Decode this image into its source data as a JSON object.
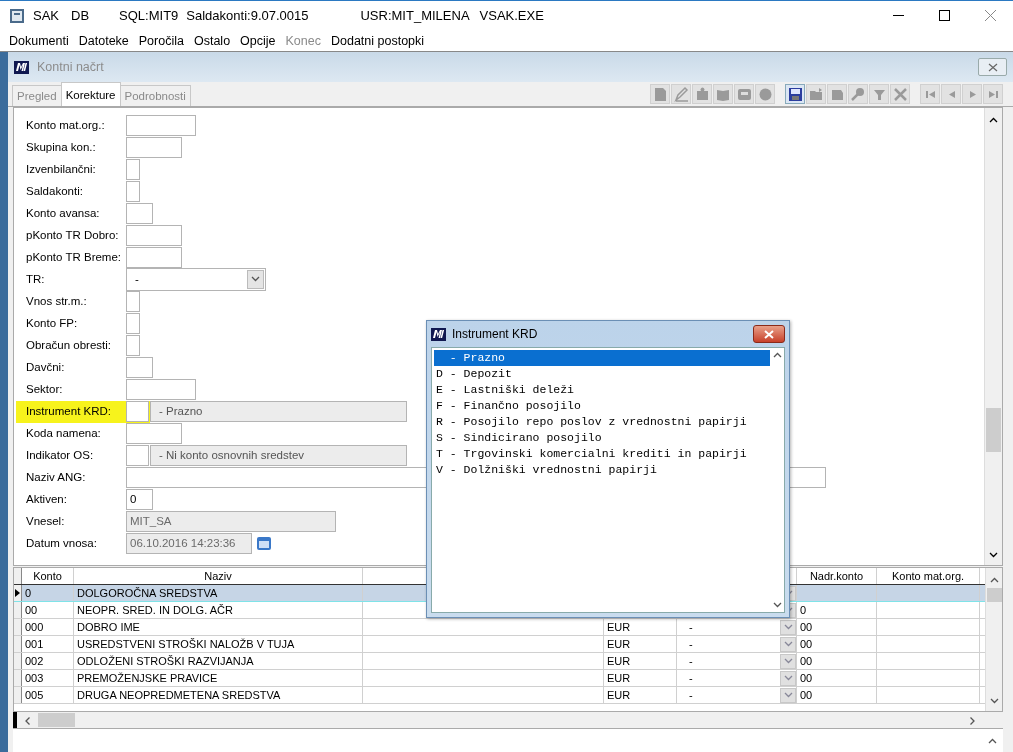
{
  "window": {
    "title_parts": [
      "SAK",
      "DB",
      "SQL:MIT9",
      "Saldakonti:9.07.0015",
      "USR:MIT_MILENA",
      "VSAK.EXE"
    ]
  },
  "menu": [
    {
      "label": "Dokumenti",
      "disabled": false
    },
    {
      "label": "Datoteke",
      "disabled": false
    },
    {
      "label": "Poročila",
      "disabled": false
    },
    {
      "label": "Ostalo",
      "disabled": false
    },
    {
      "label": "Opcije",
      "disabled": false
    },
    {
      "label": "Konec",
      "disabled": true
    },
    {
      "label": "Dodatni postopki",
      "disabled": false
    }
  ],
  "child_window": {
    "title": "Kontni načrt"
  },
  "tabs": [
    {
      "label": "Pregled",
      "selected": false
    },
    {
      "label": "Korekture",
      "selected": true
    },
    {
      "label": "Podrobnosti",
      "selected": false
    }
  ],
  "toolbar": [
    {
      "kind": "document",
      "disabled": true
    },
    {
      "kind": "pencil",
      "disabled": true
    },
    {
      "kind": "puzzle",
      "disabled": true
    },
    {
      "kind": "book",
      "disabled": true
    },
    {
      "kind": "card",
      "disabled": true
    },
    {
      "kind": "circle",
      "disabled": true
    },
    {
      "kind": "save",
      "disabled": false
    },
    {
      "kind": "folder-open",
      "disabled": true
    },
    {
      "kind": "folder",
      "disabled": true
    },
    {
      "kind": "magnifier",
      "disabled": true
    },
    {
      "kind": "filter",
      "disabled": true
    },
    {
      "kind": "cross",
      "disabled": true
    },
    {
      "kind": "first",
      "disabled": true
    },
    {
      "kind": "prev",
      "disabled": true
    },
    {
      "kind": "next",
      "disabled": true
    },
    {
      "kind": "last",
      "disabled": true
    }
  ],
  "form": [
    {
      "label": "Konto mat.org.:",
      "kind": "medium"
    },
    {
      "label": "Skupina kon.:",
      "kind": "short"
    },
    {
      "label": "Izvenbilančni:",
      "kind": "tiny"
    },
    {
      "label": "Saldakonti:",
      "kind": "tiny"
    },
    {
      "label": "Konto avansa:",
      "kind": "small"
    },
    {
      "label": "pKonto TR Dobro:",
      "kind": "short"
    },
    {
      "label": "pKonto TR Breme:",
      "kind": "short"
    },
    {
      "label": "TR:",
      "kind": "combo",
      "value": "-"
    },
    {
      "label": "Vnos str.m.:",
      "kind": "tiny"
    },
    {
      "label": "Konto FP:",
      "kind": "tiny"
    },
    {
      "label": "Obračun obresti:",
      "kind": "tiny"
    },
    {
      "label": "Davčni:",
      "kind": "small"
    },
    {
      "label": "Sektor:",
      "kind": "medium"
    },
    {
      "label": "Instrument KRD:",
      "kind": "lookup",
      "description": "- Prazno",
      "highlighted": true
    },
    {
      "label": "Koda namena:",
      "kind": "short"
    },
    {
      "label": "Indikator OS:",
      "kind": "lookup",
      "description": "- Ni konto osnovnih sredstev",
      "highlighted": false
    },
    {
      "label": "Naziv ANG:",
      "kind": "full"
    },
    {
      "label": "Aktiven:",
      "kind": "small",
      "value": "0"
    },
    {
      "label": "Vnesel:",
      "kind": "readonly",
      "value": "MIT_SA"
    },
    {
      "label": "Datum vnosa:",
      "kind": "date",
      "value": "06.10.2016 14:23:36"
    }
  ],
  "table": {
    "columns": [
      "Konto",
      "Naziv",
      "Nadr.konto",
      "Konto mat.org."
    ],
    "rows": [
      {
        "konto": "0",
        "naziv": "DOLGOROČNA SREDSTVA",
        "selected": true
      },
      {
        "konto": "00",
        "naziv": "NEOPR. SRED. IN DOLG. AČR",
        "nadr_konto": "0",
        "selected": false
      },
      {
        "konto": "000",
        "naziv": "DOBRO IME",
        "currency": "EUR",
        "type": "-",
        "nadr_konto": "00",
        "selected": false
      },
      {
        "konto": "001",
        "naziv": "USREDSTVENI STROŠKI NALOŽB V TUJA",
        "currency": "EUR",
        "type": "-",
        "nadr_konto": "00",
        "selected": false
      },
      {
        "konto": "002",
        "naziv": "ODLOŽENI STROŠKI RAZVIJANJA",
        "currency": "EUR",
        "type": "-",
        "nadr_konto": "00",
        "selected": false
      },
      {
        "konto": "003",
        "naziv": "PREMOŽENJSKE PRAVICE",
        "currency": "EUR",
        "type": "-",
        "nadr_konto": "00",
        "selected": false
      },
      {
        "konto": "005",
        "naziv": "DRUGA NEOPREDMETENA SREDSTVA",
        "currency": "EUR",
        "type": "-",
        "nadr_konto": "00",
        "selected": false
      }
    ]
  },
  "dialog": {
    "title": "Instrument KRD",
    "items": [
      {
        "label": "  - Prazno",
        "selected": true
      },
      {
        "label": "D - Depozit",
        "selected": false
      },
      {
        "label": "E - Lastniški deleži",
        "selected": false
      },
      {
        "label": "F - Finančno posojilo",
        "selected": false
      },
      {
        "label": "R - Posojilo repo poslov z vrednostni papirji",
        "selected": false
      },
      {
        "label": "S - Sindicirano posojilo",
        "selected": false
      },
      {
        "label": "T - Trgovinski komercialni krediti in papirji",
        "selected": false
      },
      {
        "label": "V - Dolžniški vrednostni papirji",
        "selected": false
      }
    ]
  }
}
